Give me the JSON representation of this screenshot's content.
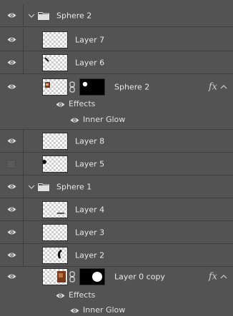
{
  "layers_panel": {
    "group_sphere2": {
      "name": "Sphere 2"
    },
    "layer7": {
      "name": "Layer 7"
    },
    "layer6": {
      "name": "Layer 6"
    },
    "sphere2_layer": {
      "name": "Sphere 2",
      "fx": "fx"
    },
    "sphere2_effects": {
      "effects_label": "Effects",
      "inner_glow_label": "Inner Glow"
    },
    "layer8": {
      "name": "Layer 8"
    },
    "layer5": {
      "name": "Layer 5"
    },
    "group_sphere1": {
      "name": "Sphere 1"
    },
    "layer4": {
      "name": "Layer 4"
    },
    "layer3": {
      "name": "Layer 3"
    },
    "layer2": {
      "name": "Layer 2"
    },
    "layer0copy": {
      "name": "Layer 0 copy",
      "fx": "fx"
    },
    "layer0copy_effects": {
      "effects_label": "Effects",
      "inner_glow_label": "Inner Glow"
    }
  },
  "colors": {
    "panel_bg": "#535353",
    "divider": "#3f3f3f",
    "text": "#e8e8e8"
  },
  "icons": {
    "visibility": "eye-icon",
    "group": "folder-icon",
    "expand": "chevron-down-icon",
    "link": "chain-link-icon",
    "effects": "fx-icon",
    "collapse": "caret-up-icon"
  }
}
